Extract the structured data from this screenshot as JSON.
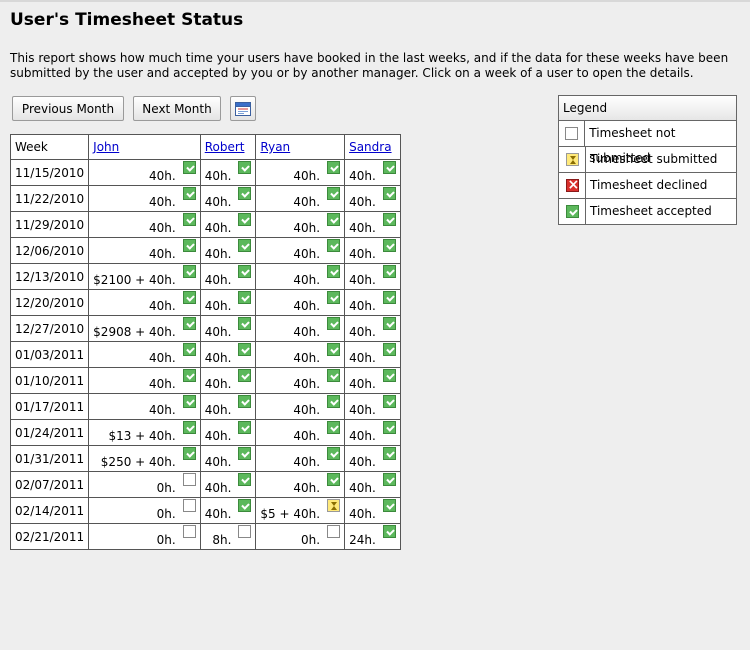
{
  "page": {
    "title": "User's Timesheet Status",
    "intro": "This report shows how much time your users have booked in the last weeks, and if the data for these weeks have been submitted by the user and accepted by you or by another manager. Click on a week of a user to open the details."
  },
  "toolbar": {
    "prev_label": "Previous Month",
    "next_label": "Next Month",
    "calendar_icon": "calendar-icon"
  },
  "legend": {
    "title": "Legend",
    "items": [
      {
        "status": "not_submitted",
        "label": "Timesheet not submitted"
      },
      {
        "status": "submitted",
        "label": "Timesheet submitted"
      },
      {
        "status": "declined",
        "label": "Timesheet declined"
      },
      {
        "status": "accepted",
        "label": "Timesheet accepted"
      }
    ]
  },
  "colors": {
    "accepted": "#5cb85c",
    "submitted": "#ffe97a",
    "declined": "#d9302c",
    "link": "#0000cc"
  },
  "table": {
    "week_header": "Week",
    "users": [
      "John",
      "Robert",
      "Ryan",
      "Sandra"
    ],
    "rows": [
      {
        "week": "11/15/2010",
        "cells": [
          {
            "v": "40h.",
            "s": "accepted"
          },
          {
            "v": "40h.",
            "s": "accepted"
          },
          {
            "v": "40h.",
            "s": "accepted"
          },
          {
            "v": "40h.",
            "s": "accepted"
          }
        ]
      },
      {
        "week": "11/22/2010",
        "cells": [
          {
            "v": "40h.",
            "s": "accepted"
          },
          {
            "v": "40h.",
            "s": "accepted"
          },
          {
            "v": "40h.",
            "s": "accepted"
          },
          {
            "v": "40h.",
            "s": "accepted"
          }
        ]
      },
      {
        "week": "11/29/2010",
        "cells": [
          {
            "v": "40h.",
            "s": "accepted"
          },
          {
            "v": "40h.",
            "s": "accepted"
          },
          {
            "v": "40h.",
            "s": "accepted"
          },
          {
            "v": "40h.",
            "s": "accepted"
          }
        ]
      },
      {
        "week": "12/06/2010",
        "cells": [
          {
            "v": "40h.",
            "s": "accepted"
          },
          {
            "v": "40h.",
            "s": "accepted"
          },
          {
            "v": "40h.",
            "s": "accepted"
          },
          {
            "v": "40h.",
            "s": "accepted"
          }
        ]
      },
      {
        "week": "12/13/2010",
        "cells": [
          {
            "v": "$2100 + 40h.",
            "s": "accepted"
          },
          {
            "v": "40h.",
            "s": "accepted"
          },
          {
            "v": "40h.",
            "s": "accepted"
          },
          {
            "v": "40h.",
            "s": "accepted"
          }
        ]
      },
      {
        "week": "12/20/2010",
        "cells": [
          {
            "v": "40h.",
            "s": "accepted"
          },
          {
            "v": "40h.",
            "s": "accepted"
          },
          {
            "v": "40h.",
            "s": "accepted"
          },
          {
            "v": "40h.",
            "s": "accepted"
          }
        ]
      },
      {
        "week": "12/27/2010",
        "cells": [
          {
            "v": "$2908 + 40h.",
            "s": "accepted"
          },
          {
            "v": "40h.",
            "s": "accepted"
          },
          {
            "v": "40h.",
            "s": "accepted"
          },
          {
            "v": "40h.",
            "s": "accepted"
          }
        ]
      },
      {
        "week": "01/03/2011",
        "cells": [
          {
            "v": "40h.",
            "s": "accepted"
          },
          {
            "v": "40h.",
            "s": "accepted"
          },
          {
            "v": "40h.",
            "s": "accepted"
          },
          {
            "v": "40h.",
            "s": "accepted"
          }
        ]
      },
      {
        "week": "01/10/2011",
        "cells": [
          {
            "v": "40h.",
            "s": "accepted"
          },
          {
            "v": "40h.",
            "s": "accepted"
          },
          {
            "v": "40h.",
            "s": "accepted"
          },
          {
            "v": "40h.",
            "s": "accepted"
          }
        ]
      },
      {
        "week": "01/17/2011",
        "cells": [
          {
            "v": "40h.",
            "s": "accepted"
          },
          {
            "v": "40h.",
            "s": "accepted"
          },
          {
            "v": "40h.",
            "s": "accepted"
          },
          {
            "v": "40h.",
            "s": "accepted"
          }
        ]
      },
      {
        "week": "01/24/2011",
        "cells": [
          {
            "v": "$13 + 40h.",
            "s": "accepted"
          },
          {
            "v": "40h.",
            "s": "accepted"
          },
          {
            "v": "40h.",
            "s": "accepted"
          },
          {
            "v": "40h.",
            "s": "accepted"
          }
        ]
      },
      {
        "week": "01/31/2011",
        "cells": [
          {
            "v": "$250 + 40h.",
            "s": "accepted"
          },
          {
            "v": "40h.",
            "s": "accepted"
          },
          {
            "v": "40h.",
            "s": "accepted"
          },
          {
            "v": "40h.",
            "s": "accepted"
          }
        ]
      },
      {
        "week": "02/07/2011",
        "cells": [
          {
            "v": "0h.",
            "s": "not_submitted"
          },
          {
            "v": "40h.",
            "s": "accepted"
          },
          {
            "v": "40h.",
            "s": "accepted"
          },
          {
            "v": "40h.",
            "s": "accepted"
          }
        ]
      },
      {
        "week": "02/14/2011",
        "cells": [
          {
            "v": "0h.",
            "s": "not_submitted"
          },
          {
            "v": "40h.",
            "s": "accepted"
          },
          {
            "v": "$5 + 40h.",
            "s": "submitted"
          },
          {
            "v": "40h.",
            "s": "accepted"
          }
        ]
      },
      {
        "week": "02/21/2011",
        "cells": [
          {
            "v": "0h.",
            "s": "not_submitted"
          },
          {
            "v": "8h.",
            "s": "not_submitted"
          },
          {
            "v": "0h.",
            "s": "not_submitted"
          },
          {
            "v": "24h.",
            "s": "accepted"
          }
        ]
      }
    ]
  }
}
